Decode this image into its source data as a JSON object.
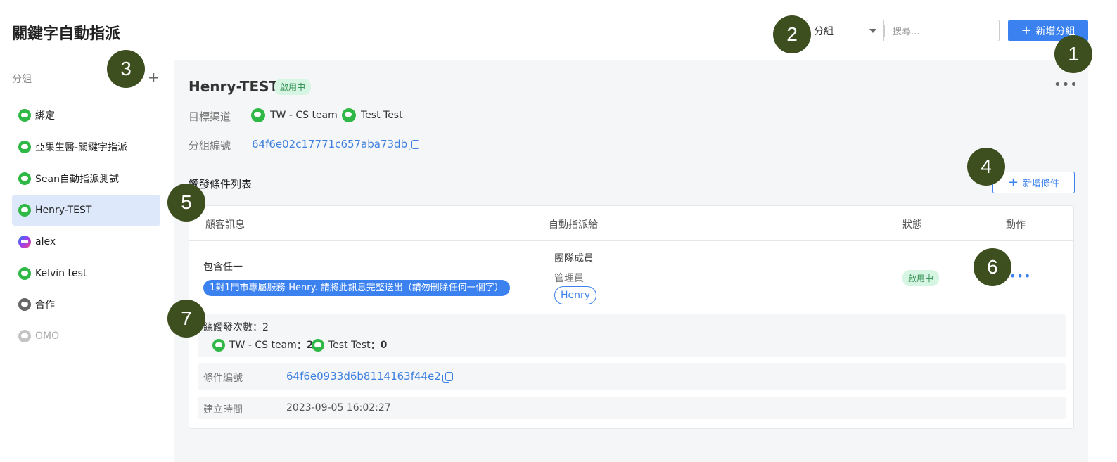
{
  "page_title": "關鍵字自動指派",
  "toolbar": {
    "select_value": "分組",
    "search_placeholder": "搜尋...",
    "add_group_label": "新增分組"
  },
  "sidebar": {
    "heading": "分組",
    "items": [
      {
        "label": "綁定",
        "icon": "line-icon"
      },
      {
        "label": "亞果生醫-關鍵字指派",
        "icon": "line-icon"
      },
      {
        "label": "Sean自動指派測試",
        "icon": "line-icon"
      },
      {
        "label": "Henry-TEST",
        "icon": "line-icon",
        "active": true
      },
      {
        "label": "alex",
        "icon": "messenger-icon"
      },
      {
        "label": "Kelvin test",
        "icon": "line-icon"
      },
      {
        "label": "合作",
        "icon": "omo-icon"
      },
      {
        "label": "OMO",
        "icon": "line-icon",
        "disabled": true
      }
    ]
  },
  "group": {
    "name": "Henry-TEST",
    "status": "啟用中",
    "channel_label": "目標渠道",
    "channels": [
      "TW - CS team",
      "Test Test"
    ],
    "id_label": "分組編號",
    "id": "64f6e02c17771c657aba73db"
  },
  "conditions": {
    "title": "觸發條件列表",
    "add_label": "新增條件",
    "columns": [
      "顧客訊息",
      "自動指派給",
      "狀態",
      "動作"
    ],
    "row": {
      "match_type": "包含任一",
      "keyword": "1對1門市專屬服務-Henry. 請將此訊息完整送出（請勿刪除任何一個字）",
      "assign_type": "團隊成員",
      "role": "管理員",
      "member": "Henry",
      "status": "啟用中"
    },
    "stats": {
      "total_label": "總觸發次數：",
      "total": "2",
      "channels": [
        {
          "name": "TW - CS team",
          "sep": "：",
          "count": "2"
        },
        {
          "name": "Test Test",
          "sep": "：",
          "count": "0"
        }
      ]
    },
    "condition_id_label": "條件編號",
    "condition_id": "64f6e0933d6b8114163f44e2",
    "created_label": "建立時間",
    "created": "2023-09-05 16:02:27"
  },
  "markers": [
    "1",
    "2",
    "3",
    "4",
    "5",
    "6",
    "7"
  ]
}
